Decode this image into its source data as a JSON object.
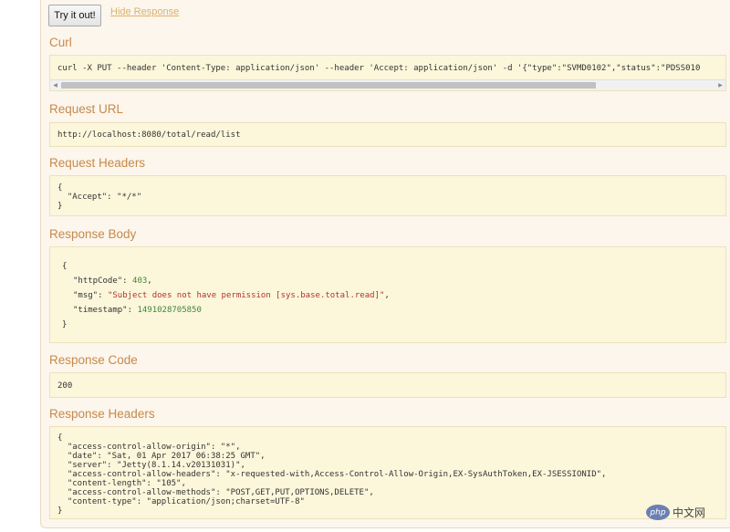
{
  "controls": {
    "try_label": "Try it out!",
    "hide_label": "Hide Response"
  },
  "sections": {
    "curl": "Curl",
    "request_url": "Request URL",
    "request_headers": "Request Headers",
    "response_body": "Response Body",
    "response_code": "Response Code",
    "response_headers": "Response Headers"
  },
  "curl_command": "curl -X PUT --header 'Content-Type: application/json' --header 'Accept: application/json' -d '{\"type\":\"SVMD0102\",\"status\":\"PDSS010",
  "request_url": "http://localhost:8080/total/read/list",
  "request_headers": {
    "open": "{",
    "line": "  \"Accept\": \"*/*\"",
    "close": "}"
  },
  "response_body": {
    "open": "{",
    "http_code_key": "\"httpCode\": ",
    "http_code_val": "403",
    "msg_key": "\"msg\": ",
    "msg_val": "\"Subject does not have permission [sys.base.total.read]\"",
    "timestamp_key": "\"timestamp\": ",
    "timestamp_val": "1491028705850",
    "close": "}"
  },
  "response_code": "200",
  "response_headers": [
    "{",
    "  \"access-control-allow-origin\": \"*\",",
    "  \"date\": \"Sat, 01 Apr 2017 06:38:25 GMT\",",
    "  \"server\": \"Jetty(8.1.14.v20131031)\",",
    "  \"access-control-allow-headers\": \"x-requested-with,Access-Control-Allow-Origin,EX-SysAuthToken,EX-JSESSIONID\",",
    "  \"content-length\": \"105\",",
    "  \"access-control-allow-methods\": \"POST,GET,PUT,OPTIONS,DELETE\",",
    "  \"content-type\": \"application/json;charset=UTF-8\"",
    "}"
  ],
  "watermark": {
    "logo": "php",
    "text": "中文网"
  },
  "icons": {
    "scroll_left": "scroll-left-arrow-icon",
    "scroll_right": "scroll-right-arrow-icon"
  }
}
